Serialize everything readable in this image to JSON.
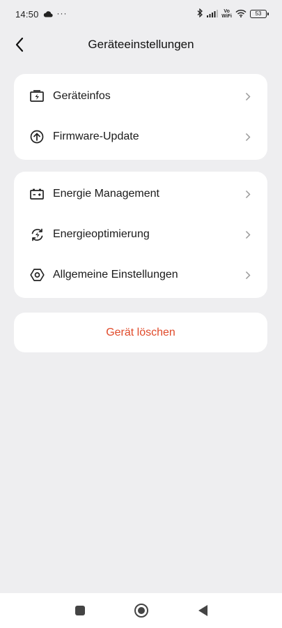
{
  "status_bar": {
    "time": "14:50",
    "cloud_icon": "cloud-icon",
    "overflow": "···",
    "vo": "Vo",
    "wifi_label": "WiFi",
    "battery": "53"
  },
  "header": {
    "title": "Geräteeinstellungen",
    "back_icon": "chevron-left-icon"
  },
  "group1": [
    {
      "label": "Geräteinfos",
      "icon": "battery-bolt-icon"
    },
    {
      "label": "Firmware-Update",
      "icon": "arrow-up-circle-icon"
    }
  ],
  "group2": [
    {
      "label": "Energie Management",
      "icon": "battery-plus-minus-icon"
    },
    {
      "label": "Energieoptimierung",
      "icon": "refresh-bolt-icon"
    },
    {
      "label": "Allgemeine Einstellungen",
      "icon": "hexagon-gear-icon"
    }
  ],
  "delete": {
    "label": "Gerät löschen"
  },
  "colors": {
    "background": "#eeeef0",
    "card": "#ffffff",
    "danger": "#e04a2a",
    "chevron": "#9a9a9a"
  },
  "nav": {
    "recents_icon": "square-icon",
    "home_icon": "circle-icon",
    "back_icon": "triangle-back-icon"
  }
}
